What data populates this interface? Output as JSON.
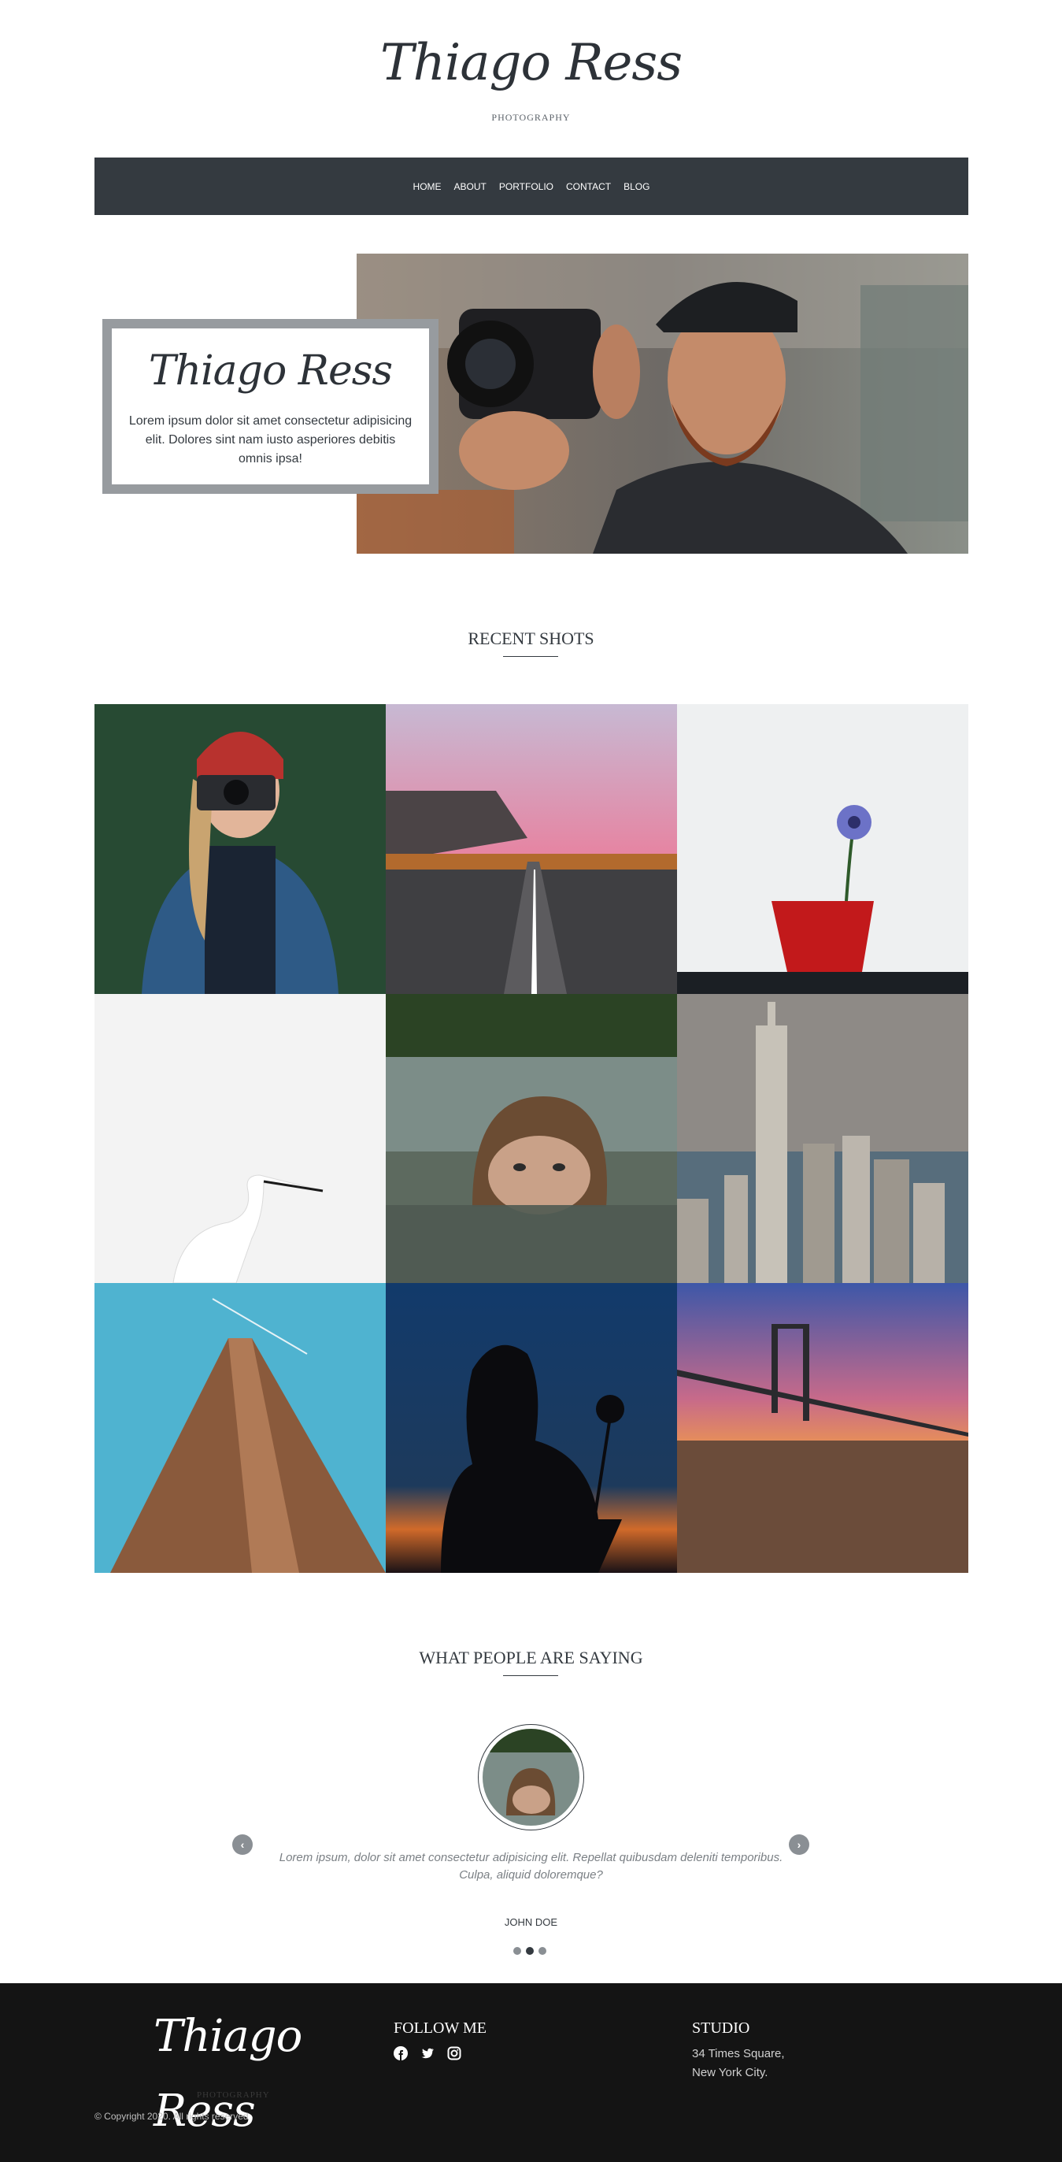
{
  "brand": {
    "logo_text": "Thiago Ress",
    "subtitle": "PHOTOGRAPHY"
  },
  "nav": {
    "items": [
      "HOME",
      "ABOUT",
      "PORTFOLIO",
      "CONTACT",
      "BLOG"
    ]
  },
  "hero": {
    "logo_text": "Thiago Ress",
    "text": "Lorem ipsum dolor sit amet consectetur adipisicing elit. Dolores sint nam iusto asperiores debitis omnis ipsa!"
  },
  "recent": {
    "title": "RECENT SHOTS"
  },
  "testimonials": {
    "title": "WHAT PEOPLE ARE SAYING",
    "quote": "Lorem ipsum, dolor sit amet consectetur adipisicing elit. Repellat quibusdam deleniti temporibus. Culpa, aliquid doloremque?",
    "name": "JOHN DOE",
    "prev_icon": "chevron-left-icon",
    "next_icon": "chevron-right-icon"
  },
  "footer": {
    "logo_text": "Thiago Ress",
    "subtitle": "PHOTOGRAPHY",
    "copyright": "© Copyright 2020. All rights reserved",
    "follow_title": "FOLLOW ME",
    "social_icons": [
      "facebook-icon",
      "twitter-icon",
      "instagram-icon"
    ],
    "studio_title": "STUDIO",
    "address_line1": "34 Times Square,",
    "address_line2": "New York City."
  },
  "colors": {
    "nav_bg": "#343a40",
    "footer_bg": "#141414",
    "card_border": "#979b9f"
  }
}
